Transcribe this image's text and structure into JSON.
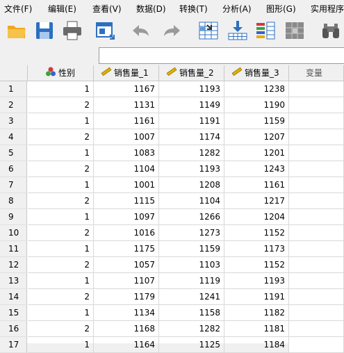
{
  "menu": {
    "items": [
      "文件(F)",
      "编辑(E)",
      "查看(V)",
      "数据(D)",
      "转换(T)",
      "分析(A)",
      "图形(G)",
      "实用程序"
    ]
  },
  "toolbar": {
    "buttons": [
      "open-folder",
      "save",
      "print",
      "dialog-recall",
      "undo",
      "redo",
      "goto-case",
      "goto-variable",
      "variables",
      "split-file",
      "find"
    ]
  },
  "grid": {
    "columns": [
      {
        "label": "性别",
        "icon": "nominal-icon"
      },
      {
        "label": "销售量_1",
        "icon": "scale-icon"
      },
      {
        "label": "销售量_2",
        "icon": "scale-icon"
      },
      {
        "label": "销售量_3",
        "icon": "scale-icon"
      },
      {
        "label": "变量",
        "icon": ""
      }
    ],
    "rows": [
      {
        "n": "1",
        "cells": [
          "1",
          "1167",
          "1193",
          "1238"
        ]
      },
      {
        "n": "2",
        "cells": [
          "2",
          "1131",
          "1149",
          "1190"
        ]
      },
      {
        "n": "3",
        "cells": [
          "1",
          "1161",
          "1191",
          "1159"
        ]
      },
      {
        "n": "4",
        "cells": [
          "2",
          "1007",
          "1174",
          "1207"
        ]
      },
      {
        "n": "5",
        "cells": [
          "1",
          "1083",
          "1282",
          "1201"
        ]
      },
      {
        "n": "6",
        "cells": [
          "2",
          "1104",
          "1193",
          "1243"
        ]
      },
      {
        "n": "7",
        "cells": [
          "1",
          "1001",
          "1208",
          "1161"
        ]
      },
      {
        "n": "8",
        "cells": [
          "2",
          "1115",
          "1104",
          "1217"
        ]
      },
      {
        "n": "9",
        "cells": [
          "1",
          "1097",
          "1266",
          "1204"
        ]
      },
      {
        "n": "10",
        "cells": [
          "2",
          "1016",
          "1273",
          "1152"
        ]
      },
      {
        "n": "11",
        "cells": [
          "1",
          "1175",
          "1159",
          "1173"
        ]
      },
      {
        "n": "12",
        "cells": [
          "2",
          "1057",
          "1103",
          "1152"
        ]
      },
      {
        "n": "13",
        "cells": [
          "1",
          "1107",
          "1119",
          "1193"
        ]
      },
      {
        "n": "14",
        "cells": [
          "2",
          "1179",
          "1241",
          "1191"
        ]
      },
      {
        "n": "15",
        "cells": [
          "1",
          "1134",
          "1158",
          "1182"
        ]
      },
      {
        "n": "16",
        "cells": [
          "2",
          "1168",
          "1282",
          "1181"
        ]
      },
      {
        "n": "17",
        "cells": [
          "1",
          "1164",
          "1125",
          "1184"
        ]
      }
    ]
  },
  "colors": {
    "accent": "#2d6fc0",
    "nominal_red": "#d23a3a",
    "nominal_green": "#3aa33a",
    "nominal_blue": "#3a5fd2",
    "scale_yellow": "#e0b000"
  }
}
